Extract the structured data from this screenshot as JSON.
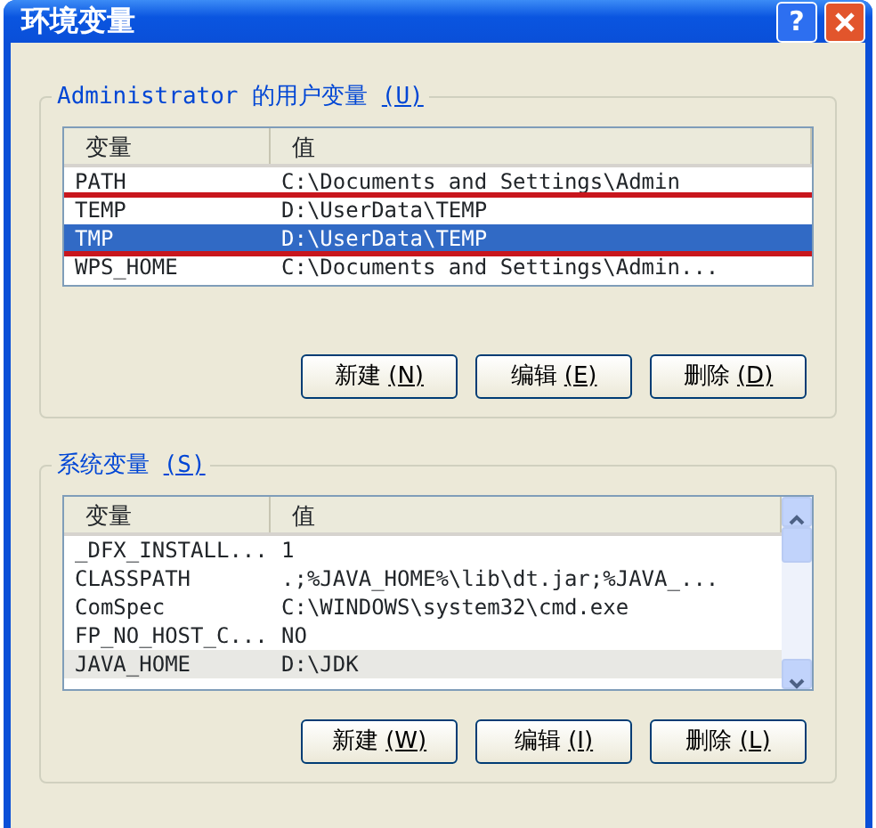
{
  "window": {
    "title": "环境变量",
    "help_button": "?"
  },
  "user_variables": {
    "label": "Administrator 的用户变量",
    "mnemonic": "(U)",
    "columns": [
      "变量",
      "值"
    ],
    "active": true,
    "rows": [
      {
        "name": "PATH",
        "value": "C:\\Documents and Settings\\Admin",
        "selected": false
      },
      {
        "name": "TEMP",
        "value": "D:\\UserData\\TEMP",
        "selected": false
      },
      {
        "name": "TMP",
        "value": "D:\\UserData\\TEMP",
        "selected": true
      },
      {
        "name": "WPS_HOME",
        "value": "C:\\Documents and Settings\\Admin...",
        "selected": false
      }
    ],
    "buttons": [
      {
        "label": "新建",
        "mnemonic": "(N)"
      },
      {
        "label": "编辑",
        "mnemonic": "(E)"
      },
      {
        "label": "删除",
        "mnemonic": "(D)"
      }
    ]
  },
  "system_variables": {
    "label": "系统变量",
    "mnemonic": "(S)",
    "columns": [
      "变量",
      "值"
    ],
    "active": false,
    "rows": [
      {
        "name": "_DFX_INSTALL...",
        "value": "1",
        "selected": false
      },
      {
        "name": "CLASSPATH",
        "value": ".;%JAVA_HOME%\\lib\\dt.jar;%JAVA_...",
        "selected": false
      },
      {
        "name": "ComSpec",
        "value": "C:\\WINDOWS\\system32\\cmd.exe",
        "selected": false
      },
      {
        "name": "FP_NO_HOST_C...",
        "value": "NO",
        "selected": false
      },
      {
        "name": "JAVA_HOME",
        "value": "D:\\JDK",
        "selected": true
      }
    ],
    "buttons": [
      {
        "label": "新建",
        "mnemonic": "(W)"
      },
      {
        "label": "编辑",
        "mnemonic": "(I)"
      },
      {
        "label": "删除",
        "mnemonic": "(L)"
      }
    ]
  }
}
